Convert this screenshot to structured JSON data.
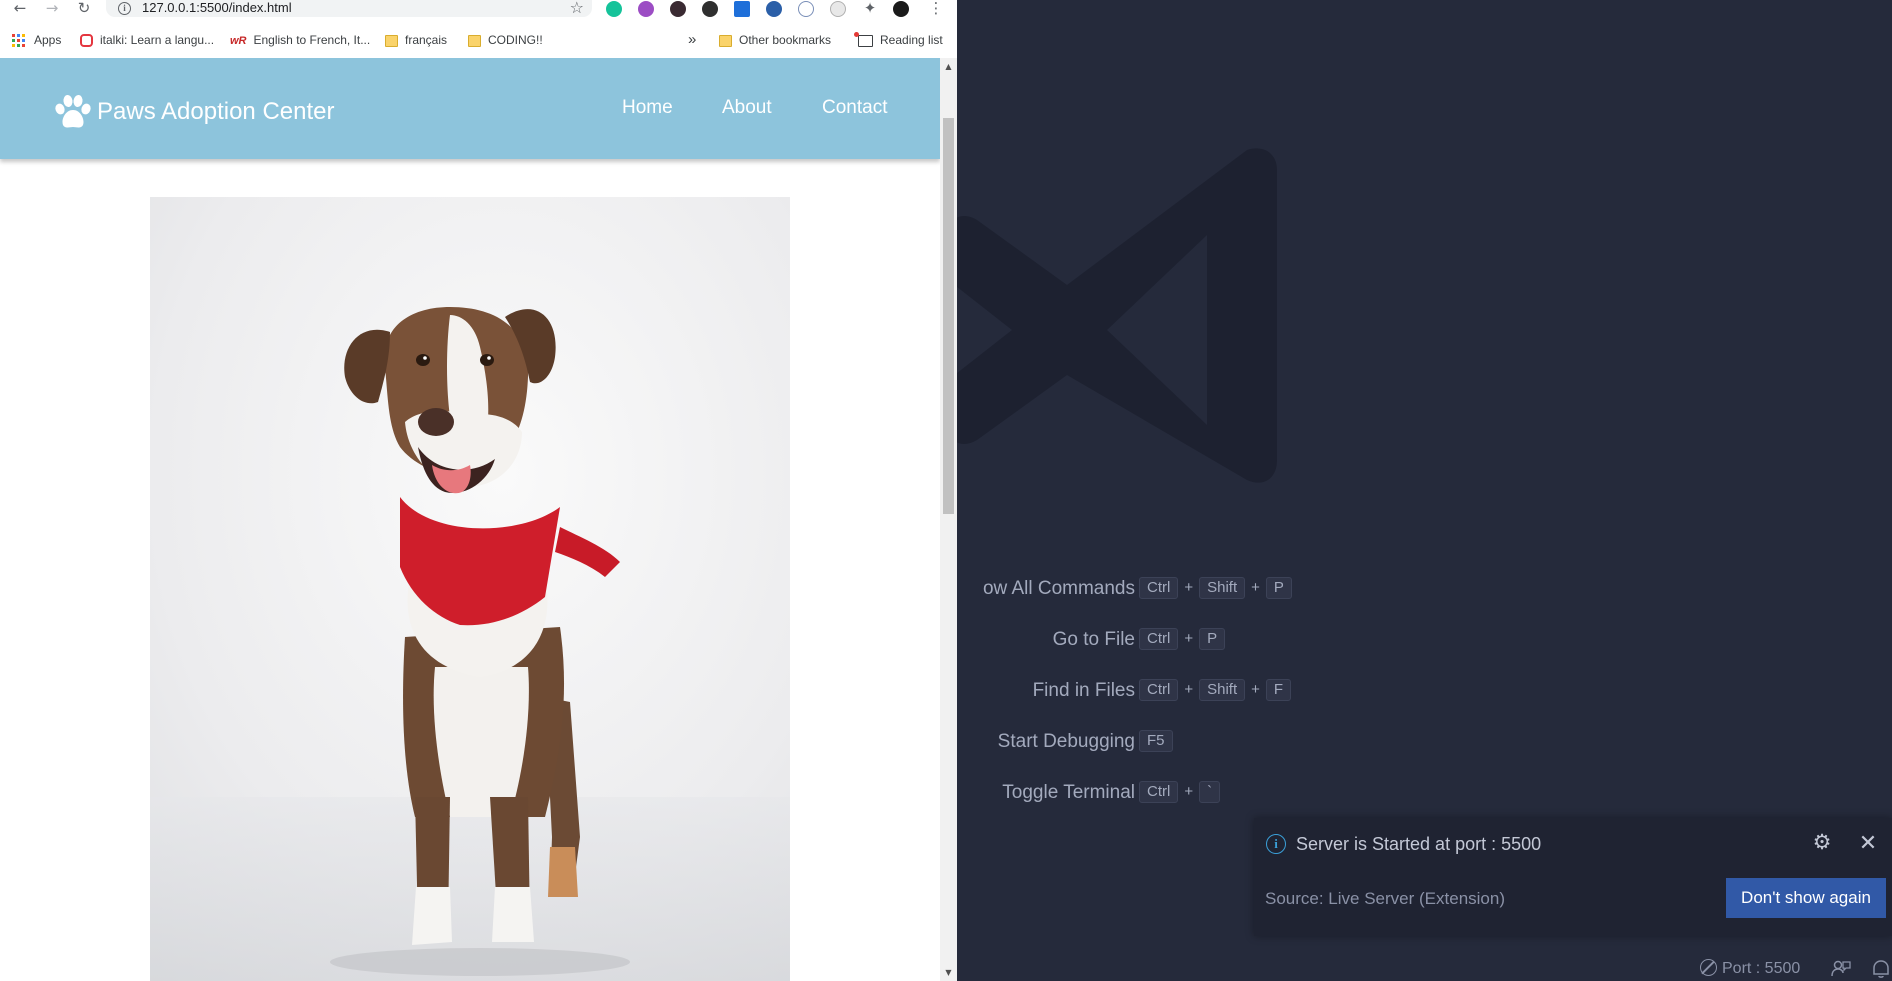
{
  "browser": {
    "url": "127.0.0.1:5500/index.html",
    "nav": {
      "back_icon": "back-arrow-icon",
      "forward_icon": "forward-arrow-icon",
      "reload_icon": "reload-icon",
      "menu_icon": "more-vert-icon"
    },
    "bookmarks": [
      {
        "label": "Apps",
        "icon": "apps-grid-icon"
      },
      {
        "label": "italki: Learn a langu...",
        "icon": "italki-icon"
      },
      {
        "label": "English to French, It...",
        "icon": "wordreference-icon"
      },
      {
        "label": "français",
        "icon": "folder-icon"
      },
      {
        "label": "CODING!!",
        "icon": "folder-icon"
      }
    ],
    "overflow_label": "»",
    "other_bookmarks": "Other bookmarks",
    "reading_list": "Reading list"
  },
  "site": {
    "brand": "Paws Adoption Center",
    "nav": [
      "Home",
      "About",
      "Contact"
    ],
    "hero_alt": "Smiling brown and white dog wearing a red bandana"
  },
  "vscode": {
    "shortcuts": [
      {
        "label": "ow All Commands",
        "keys": [
          "Ctrl",
          "Shift",
          "P"
        ]
      },
      {
        "label": "Go to File",
        "keys": [
          "Ctrl",
          "P"
        ]
      },
      {
        "label": "Find in Files",
        "keys": [
          "Ctrl",
          "Shift",
          "F"
        ]
      },
      {
        "label": "Start Debugging",
        "keys": [
          "F5"
        ]
      },
      {
        "label": "Toggle Terminal",
        "keys": [
          "Ctrl",
          "`"
        ]
      }
    ],
    "notification": {
      "message": "Server is Started at port : 5500",
      "source": "Source: Live Server (Extension)",
      "button": "Don't show again"
    },
    "statusbar": {
      "port": "Port : 5500"
    }
  },
  "colors": {
    "header_bg": "#8dc4dc",
    "editor_bg": "#252a3b",
    "button_bg": "#3159a7",
    "info_accent": "#3a9fd8"
  }
}
